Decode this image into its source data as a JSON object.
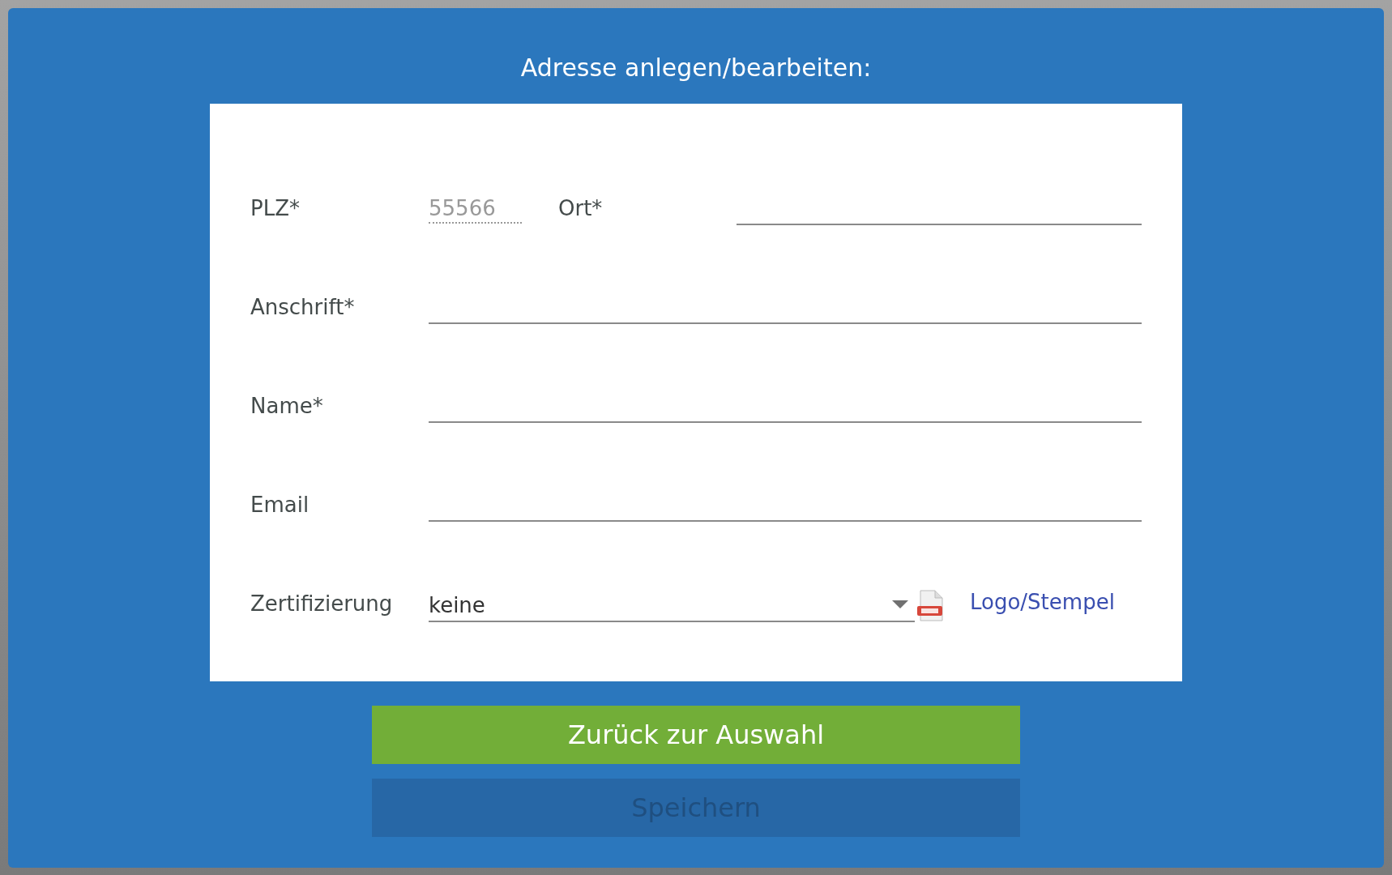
{
  "dialog": {
    "title": "Adresse anlegen/bearbeiten:",
    "fields": [
      {
        "kind": "pair",
        "label": "PLZ*",
        "value": "55566",
        "disabled": true,
        "second_label": "Ort*"
      },
      {
        "kind": "text",
        "label": "Anschrift*"
      },
      {
        "kind": "text",
        "label": "Name*"
      },
      {
        "kind": "text",
        "label": "Email"
      },
      {
        "kind": "select",
        "label": "Zertifizierung",
        "value": "keine",
        "link": "Logo/Stempel"
      }
    ],
    "buttons": [
      {
        "label": "Zurück zur Auswahl",
        "kind": "primary",
        "disabled": false
      },
      {
        "label": "Speichern",
        "kind": "secondary",
        "disabled": true
      }
    ]
  }
}
